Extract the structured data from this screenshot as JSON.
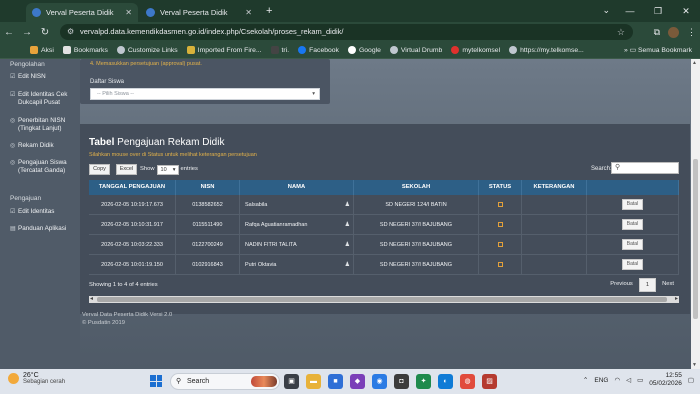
{
  "browser": {
    "tabs": [
      {
        "label": "Verval Peserta Didik",
        "active": true
      },
      {
        "label": "Verval Peserta Didik",
        "active": false
      }
    ],
    "new_tab_symbol": "+",
    "url": "vervalpd.data.kemendikdasmen.go.id/index.php/Csekolah/proses_rekam_didik/",
    "bookmarks": [
      "Aksi",
      "Bookmarks",
      "Customize Links",
      "Imported From Fire...",
      "tri.",
      "Facebook",
      "Google",
      "Virtual Drumb",
      "mytelkomsel",
      "https://my.telkomse..."
    ],
    "all_bookmarks": "Semua Bookmark"
  },
  "sidebar": {
    "section1_partial": "Pengolahan",
    "items1": [
      {
        "label": "Edit NISN"
      },
      {
        "label": "Edit Identitas Cek Dukcapil Pusat"
      },
      {
        "label": "Penerbitan NISN (Tingkat Lanjut)"
      },
      {
        "label": "Rekam Didik"
      },
      {
        "label": "Pengajuan Siswa (Tercatat Ganda)"
      }
    ],
    "section2": "Pengajuan",
    "items2": [
      {
        "label": "Edit Identitas"
      },
      {
        "label": "Panduan Aplikasi"
      }
    ]
  },
  "top_card": {
    "hint": "4. Memasukkan persetujuan (approval) pusat.",
    "daftar_label": "Daftar Siswa",
    "select_placeholder": "-- Pilih Siswa --"
  },
  "panel": {
    "title_bold": "Tabel",
    "title_rest": " Pengajuan Rekam Didik",
    "subtitle": "Silahkan mouse over di Status untuk melihat keterangan persetujuan",
    "copy_label": "Copy",
    "excel_label": "Excel",
    "show_label": "Show",
    "show_value": "10",
    "entries_label": "entries",
    "search_label": "Search:",
    "columns": [
      "TANGGAL PENGAJUAN",
      "NISN",
      "NAMA",
      "SEKOLAH",
      "STATUS",
      "KETERANGAN",
      ""
    ],
    "rows": [
      {
        "tanggal": "2026-02-05 10:19:17.673",
        "nisn": "0138582652",
        "nama": "Salsabila",
        "sekolah": "SD NEGERI 124/I BATIN"
      },
      {
        "tanggal": "2026-02-05 10:10:31.917",
        "nisn": "0115511490",
        "nama": "Rafqa Aguatianramadhan",
        "sekolah": "SD NEGERI 37/I BAJUBANG"
      },
      {
        "tanggal": "2026-02-05 10:03:22.333",
        "nisn": "0122700249",
        "nama": "NADIN FITRI TALITA",
        "sekolah": "SD NEGERI 37/I BAJUBANG"
      },
      {
        "tanggal": "2026-02-05 10:01:19.150",
        "nisn": "0102916843",
        "nama": "Putri Oktavia",
        "sekolah": "SD NEGERI 37/I BAJUBANG"
      }
    ],
    "batal_label": "Batal",
    "showing_text": "Showing 1 to 4 of 4 entries",
    "prev_label": "Previous",
    "page_label": "1",
    "next_label": "Next"
  },
  "footer": {
    "line1": "Verval Data Peserta Didik Versi 2.0",
    "line2": "© Pusdatin 2019"
  },
  "taskbar": {
    "temperature": "26°C",
    "weather": "Sebagian cerah",
    "search_label": "Search",
    "lang": "ENG",
    "time": "12:55",
    "date": "05/02/2026"
  }
}
